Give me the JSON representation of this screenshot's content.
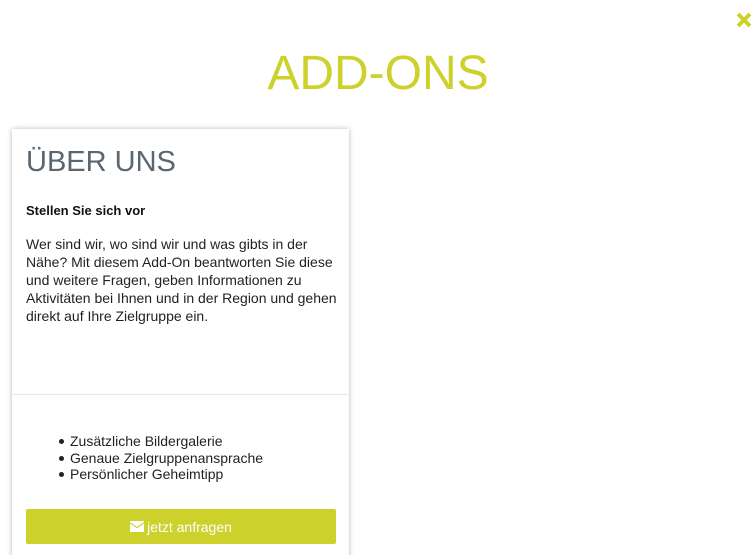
{
  "colors": {
    "accent": "#cdd12b",
    "card_title": "#5a6670",
    "text": "#222222"
  },
  "header": {
    "title": "ADD-ONS",
    "close_icon": "close-x-icon"
  },
  "addon_card": {
    "title": "ÜBER UNS",
    "subtitle": "Stellen Sie sich vor",
    "description": "Wer sind wir, wo sind wir und was gibts in der Nähe? Mit diesem Add-On beantworten Sie diese und weitere Fragen, geben Informationen zu Aktivitäten bei Ihnen und in der Region und gehen direkt auf Ihre Zielgruppe ein.",
    "features": [
      "Zusätzliche Bildergalerie",
      "Genaue Zielgruppenansprache",
      "Persönlicher Geheimtipp"
    ],
    "cta_label": "jetzt anfragen",
    "cta_icon": "envelope-icon"
  }
}
